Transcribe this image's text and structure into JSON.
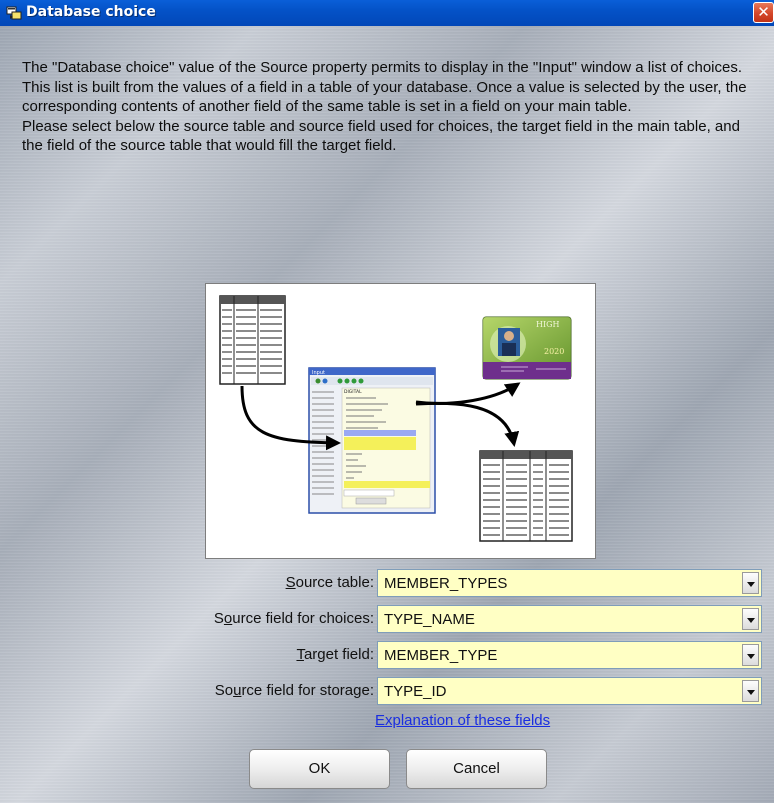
{
  "window": {
    "title": "Database choice",
    "close_glyph": "✕"
  },
  "description": [
    "The \"Database choice\" value of the Source property permits to display in the \"Input\" window a list of choices.",
    "This list is built from the values of a field in a table of your database. Once a value is selected by the user, the corresponding contents of another field of the same table is set in a field on your main table.",
    "Please select below the source table and source field used for choices, the target field in the main table, and the field of the source table that would fill the target field."
  ],
  "fields": {
    "source_table": {
      "label_pre": "",
      "label_key": "S",
      "label_post": "ource table:",
      "value": "MEMBER_TYPES"
    },
    "source_field_choices": {
      "label_pre": "S",
      "label_key": "o",
      "label_post": "urce field for choices:",
      "value": "TYPE_NAME"
    },
    "target_field": {
      "label_pre": "",
      "label_key": "T",
      "label_post": "arget field:",
      "value": "MEMBER_TYPE"
    },
    "source_field_storage": {
      "label_pre": "So",
      "label_key": "u",
      "label_post": "rce field for storage:",
      "value": "TYPE_ID"
    }
  },
  "link": {
    "label": "Explanation of these fields"
  },
  "buttons": {
    "ok": "OK",
    "cancel": "Cancel"
  },
  "illustration": {
    "card_heading": "HIGH",
    "card_year": "2020",
    "panel_title": "Input",
    "panel_field": "DIGITAL"
  },
  "colors": {
    "combo_background": "#ffffc4",
    "title_bar": "#0452c7",
    "link": "#1a2ee0"
  }
}
